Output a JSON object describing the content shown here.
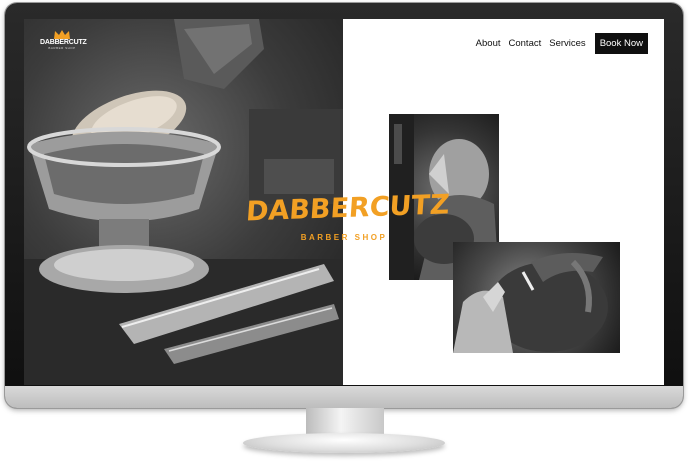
{
  "brand": {
    "logo_text": "DABBERCUTZ",
    "logo_sub": "BARBER SHOP",
    "title": "DABBERCUTZ",
    "subtitle": "BARBER SHOP",
    "accent_color": "#f2a024"
  },
  "nav": {
    "items": [
      {
        "label": "About"
      },
      {
        "label": "Contact"
      },
      {
        "label": "Services"
      }
    ],
    "cta_label": "Book Now"
  },
  "icons": {
    "logo": "crown-icon"
  }
}
